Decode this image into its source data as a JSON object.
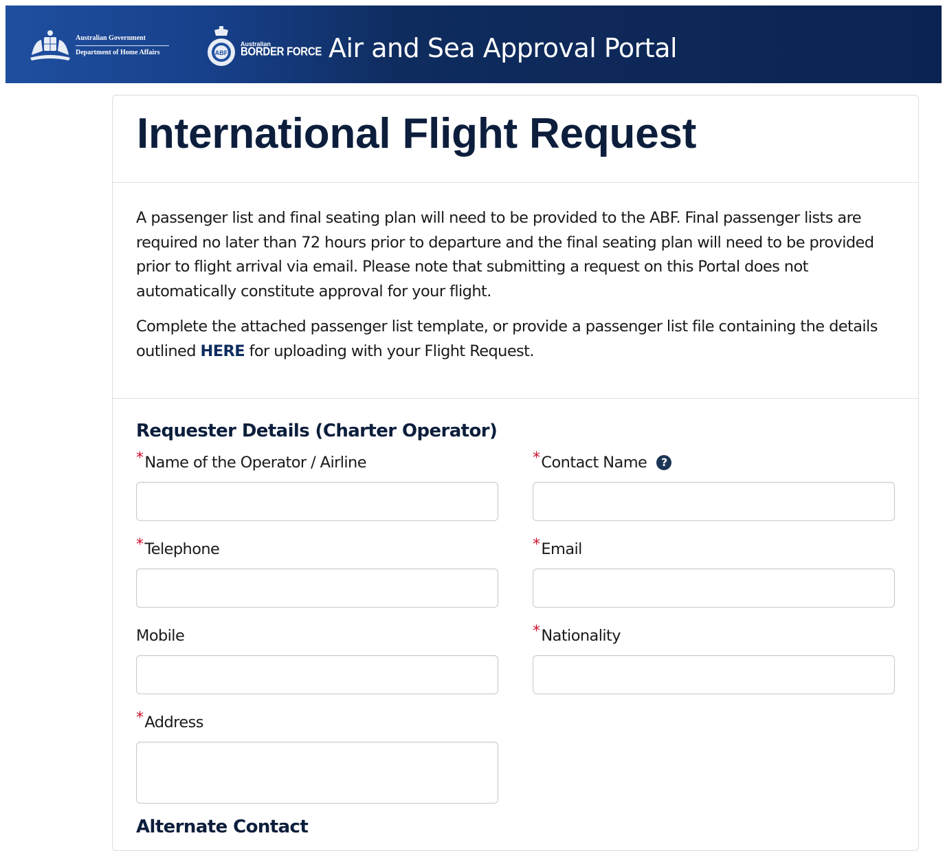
{
  "header": {
    "gov_line1": "Australian Government",
    "gov_line2": "Department of Home Affairs",
    "abf_small": "Australian",
    "abf_big": "BORDER FORCE",
    "portal_title": "Air and Sea Approval Portal"
  },
  "page": {
    "title": "International Flight Request",
    "intro_1": "A passenger list and final seating plan will need to be provided to the ABF. Final passenger lists are required no later than 72 hours prior to departure and the final seating plan will need to be provided prior to flight arrival via email. Please note that submitting a request on this Portal does not automatically constitute approval for your flight.",
    "intro_2_before": "Complete the attached passenger list template, or provide a passenger list file containing the details outlined ",
    "intro_2_link": "HERE",
    "intro_2_after": " for uploading with your Flight Request."
  },
  "requester": {
    "section_title": "Requester Details (Charter Operator)",
    "required_mark": "*",
    "help_glyph": "?",
    "fields": {
      "operator": {
        "label": "Name of the Operator / Airline",
        "value": ""
      },
      "contact_name": {
        "label": "Contact Name",
        "value": ""
      },
      "telephone": {
        "label": "Telephone",
        "value": ""
      },
      "email": {
        "label": "Email",
        "value": ""
      },
      "mobile": {
        "label": "Mobile",
        "value": ""
      },
      "nationality": {
        "label": "Nationality",
        "value": ""
      },
      "address": {
        "label": "Address",
        "value": ""
      }
    }
  },
  "next_section": {
    "title_partial": "Alternate Contact"
  },
  "colors": {
    "header_dark": "#0b2350",
    "header_light": "#1f4fa0",
    "title": "#0c1e3c",
    "required": "#c8102e"
  }
}
